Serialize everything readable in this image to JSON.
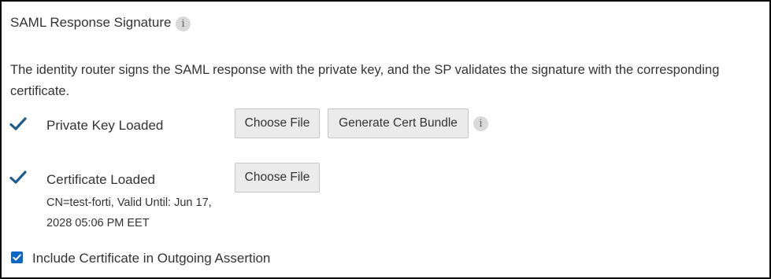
{
  "section": {
    "title": "SAML Response Signature",
    "info_glyph": "i",
    "description": "The identity router signs the SAML response with the private key, and the SP validates the signature with the corresponding certificate."
  },
  "private_key": {
    "status_icon": "check-icon",
    "label": "Private Key Loaded",
    "choose_file_label": "Choose File",
    "generate_label": "Generate Cert Bundle",
    "info_glyph": "i"
  },
  "certificate": {
    "status_icon": "check-icon",
    "label": "Certificate Loaded",
    "detail": "CN=test-forti, Valid Until: Jun 17, 2028 05:06 PM EET",
    "choose_file_label": "Choose File"
  },
  "include_cert": {
    "checked": true,
    "label": "Include Certificate in Outgoing Assertion"
  },
  "colors": {
    "check_mark": "#1f5b8c",
    "checkbox_fill": "#0b67c2",
    "button_bg": "#ebebeb",
    "text": "#333333",
    "border": "#000000"
  }
}
